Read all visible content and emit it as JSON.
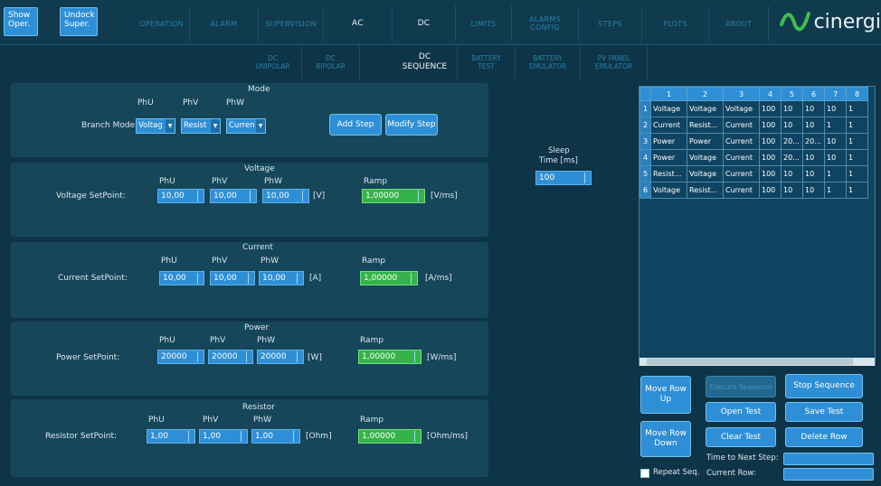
{
  "top_buttons": {
    "show_oper": "Show Oper.",
    "undock_super": "Undock Super."
  },
  "tabs": [
    "OPERATION",
    "ALARM",
    "SUPERVISION",
    "AC",
    "DC",
    "LIMITS",
    "ALARMS CONFIG",
    "STEPS",
    "PLOTS",
    "ABOUT"
  ],
  "logo_text": "cinergi",
  "subtabs": [
    "DC UNIPOLAR",
    "DC BIPOLAR",
    "DC SEQUENCE",
    "BATTERY TEST",
    "BATTERY EMULATOR",
    "PV PANEL EMULATOR"
  ],
  "mode": {
    "title": "Mode",
    "branch_label": "Branch Mode:",
    "phases": [
      "PhU",
      "PhV",
      "PhW"
    ],
    "values": [
      "Voltag",
      "Resist",
      "Curren"
    ],
    "add_step": "Add Step",
    "modify_step": "Modify Step"
  },
  "voltage": {
    "title": "Voltage",
    "label": "Voltage SetPoint:",
    "phases": [
      "PhU",
      "PhV",
      "PhW"
    ],
    "values": [
      "10,00",
      "10,00",
      "10,00"
    ],
    "unit": "[V]",
    "ramp_label": "Ramp",
    "ramp": "1,00000",
    "ramp_unit": "[V/ms]"
  },
  "current": {
    "title": "Current",
    "label": "Current SetPoint:",
    "phases": [
      "PhU",
      "PhV",
      "PhW"
    ],
    "values": [
      "10,00",
      "10,00",
      "10,00"
    ],
    "unit": "[A]",
    "ramp_label": "Ramp",
    "ramp": "1,00000",
    "ramp_unit": "[A/ms]"
  },
  "power": {
    "title": "Power",
    "label": "Power SetPoint:",
    "phases": [
      "PhU",
      "PhV",
      "PhW"
    ],
    "values": [
      "20000",
      "20000",
      "20000"
    ],
    "unit": "[W]",
    "ramp_label": "Ramp",
    "ramp": "1,00000",
    "ramp_unit": "[W/ms]"
  },
  "resistor": {
    "title": "Resistor",
    "label": "Resistor SetPoint:",
    "phases": [
      "PhU",
      "PhV",
      "PhW"
    ],
    "values": [
      "1,00",
      "1,00",
      "1,00"
    ],
    "unit": "[Ohm]",
    "ramp_label": "Ramp",
    "ramp": "1,00000",
    "ramp_unit": "[Ohm/ms]"
  },
  "sleep": {
    "label_1": "Sleep",
    "label_2": "Time [ms]",
    "value": "100"
  },
  "table": {
    "headers": [
      "1",
      "2",
      "3",
      "4",
      "5",
      "6",
      "7",
      "8"
    ],
    "rows": [
      [
        "1",
        "Voltage",
        "Voltage",
        "Voltage",
        "100",
        "10",
        "10",
        "10",
        "1"
      ],
      [
        "2",
        "Current",
        "Resist...",
        "Current",
        "100",
        "10",
        "10",
        "1",
        "1"
      ],
      [
        "3",
        "Power",
        "Power",
        "Current",
        "100",
        "20...",
        "20...",
        "10",
        "1"
      ],
      [
        "4",
        "Power",
        "Voltage",
        "Current",
        "100",
        "20...",
        "10",
        "10",
        "1"
      ],
      [
        "5",
        "Resist...",
        "Voltage",
        "Current",
        "100",
        "10",
        "10",
        "1",
        "1"
      ],
      [
        "6",
        "Voltage",
        "Resist...",
        "Current",
        "100",
        "10",
        "10",
        "1",
        "1"
      ]
    ]
  },
  "controls": {
    "move_row_up": "Move Row Up",
    "execute_sequence": "Execute Sequence",
    "stop_sequence": "Stop Sequence",
    "open_test": "Open Test",
    "save_test": "Save Test",
    "move_row_down": "Move Row Down",
    "clear_test": "Clear Test",
    "delete_row": "Delete Row",
    "time_to_next_step": "Time to Next Step:",
    "repeat_seq": "Repeat Seq.",
    "current_row": "Current Row:"
  },
  "colors": {
    "accent": "#2f8fd6",
    "ramp_green": "#35b34a",
    "background": "#0e3447"
  }
}
